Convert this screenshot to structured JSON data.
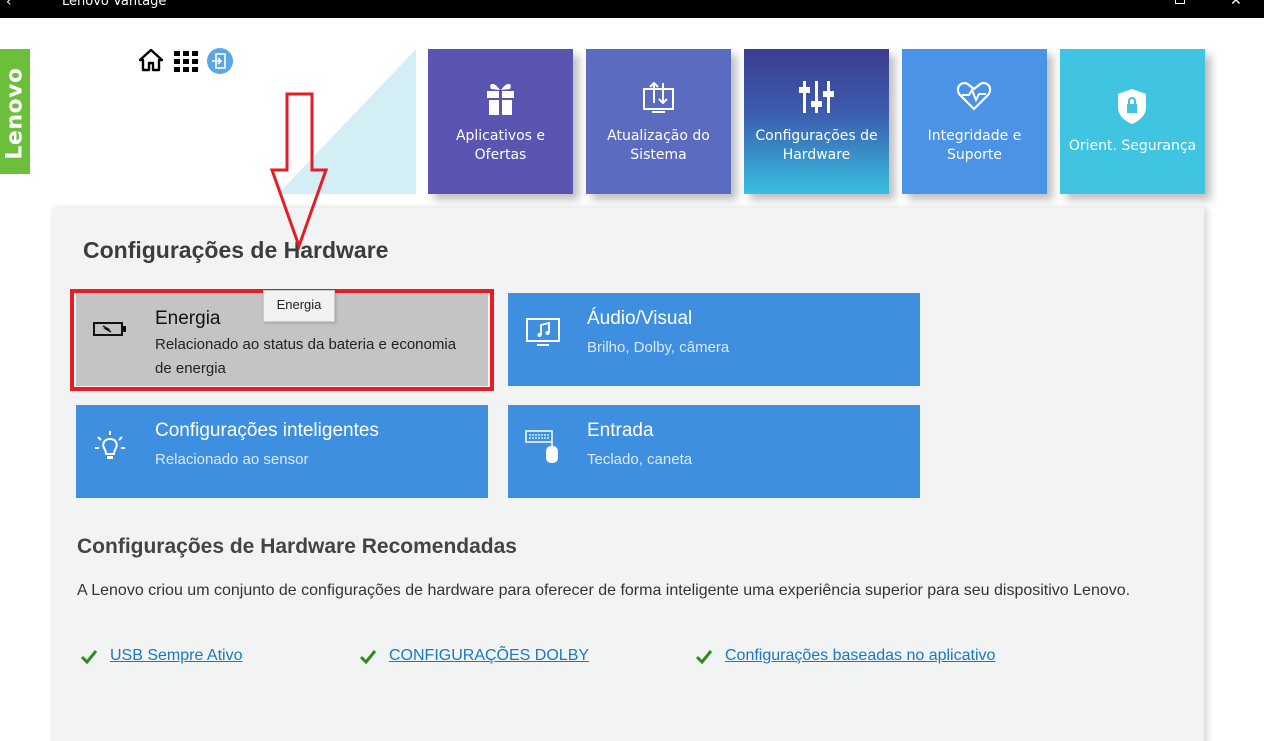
{
  "window": {
    "back_glyph": "‹",
    "title": "Lenovo Vantage",
    "close_glyph": "✕"
  },
  "brand": {
    "logo_text": "Lenovo",
    "color": "#6bbf3a"
  },
  "topnav": {
    "icons": [
      "home-icon",
      "apps-grid-icon",
      "sign-in-icon"
    ]
  },
  "tiles": [
    {
      "label": "Aplicativos e Ofertas",
      "icon": "gift-icon",
      "color": "#5a55b0"
    },
    {
      "label": "Atualização do Sistema",
      "icon": "system-update-icon",
      "color": "#5b6cc0"
    },
    {
      "label": "Configurações de Hardware",
      "icon": "sliders-icon",
      "color": "#3c5db0",
      "selected": true
    },
    {
      "label": "Integridade e Suporte",
      "icon": "heart-pulse-icon",
      "color": "#4a93e6"
    },
    {
      "label": "Orient. Segurança",
      "icon": "shield-lock-icon",
      "color": "#3fc4e1"
    }
  ],
  "main": {
    "title": "Configurações de Hardware",
    "cards": [
      {
        "title": "Energia",
        "subtitle": "Relacionado ao status da bateria e economia de energia",
        "icon": "battery-icon"
      },
      {
        "title": "Áudio/Visual",
        "subtitle": "Brilho, Dolby, câmera",
        "icon": "monitor-music-icon"
      },
      {
        "title": "Configurações inteligentes",
        "subtitle": "Relacionado ao sensor",
        "icon": "lightbulb-icon"
      },
      {
        "title": "Entrada",
        "subtitle": "Teclado, caneta",
        "icon": "keyboard-mouse-icon"
      }
    ],
    "tooltip": "Energia"
  },
  "recommended": {
    "title": "Configurações de Hardware Recomendadas",
    "description": "A Lenovo criou um conjunto de configurações de hardware para oferecer de forma inteligente uma experiência superior para seu dispositivo Lenovo.",
    "links": [
      {
        "label": "USB Sempre Ativo"
      },
      {
        "label": "CONFIGURAÇÕES DOLBY"
      },
      {
        "label": "Configurações baseadas no aplicativo"
      }
    ]
  },
  "colors": {
    "card_blue": "#3f8fe0",
    "card_hover": "#c4c4c4",
    "highlight_red": "#e41e26",
    "link": "#1a78c2",
    "check_green": "#2e8b1f"
  }
}
